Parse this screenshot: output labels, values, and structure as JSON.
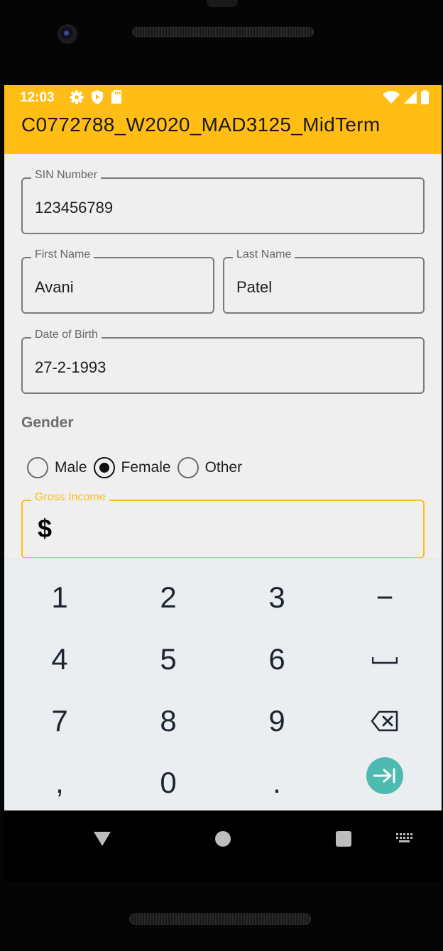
{
  "status_bar": {
    "time": "12:03",
    "left_icons": [
      "settings-icon",
      "shield-icon",
      "sd-card-icon"
    ],
    "right_icons": [
      "wifi-icon",
      "signal-icon",
      "battery-icon"
    ]
  },
  "app_bar": {
    "title": "C0772788_W2020_MAD3125_MidTerm",
    "color": "#FFBD16"
  },
  "form": {
    "sin": {
      "label": "SIN Number",
      "value": "123456789"
    },
    "first_name": {
      "label": "First Name",
      "value": "Avani"
    },
    "last_name": {
      "label": "Last Name",
      "value": "Patel"
    },
    "dob": {
      "label": "Date of Birth",
      "value": "27-2-1993"
    },
    "gender": {
      "label": "Gender",
      "options": [
        "Male",
        "Female",
        "Other"
      ],
      "selected": "Female"
    },
    "gross_income": {
      "label": "Gross Income",
      "prefix": "$",
      "value": ""
    }
  },
  "keyboard": {
    "row1": [
      "1",
      "2",
      "3",
      "−"
    ],
    "row2": [
      "4",
      "5",
      "6",
      "space-icon"
    ],
    "row3": [
      "7",
      "8",
      "9",
      "backspace-icon"
    ],
    "row4": [
      ",",
      "0",
      ".",
      "next-icon"
    ],
    "accent": "#4DBBB0"
  },
  "nav_bar": [
    "back-icon",
    "home-icon",
    "recents-icon",
    "keyboard-switch-icon"
  ]
}
